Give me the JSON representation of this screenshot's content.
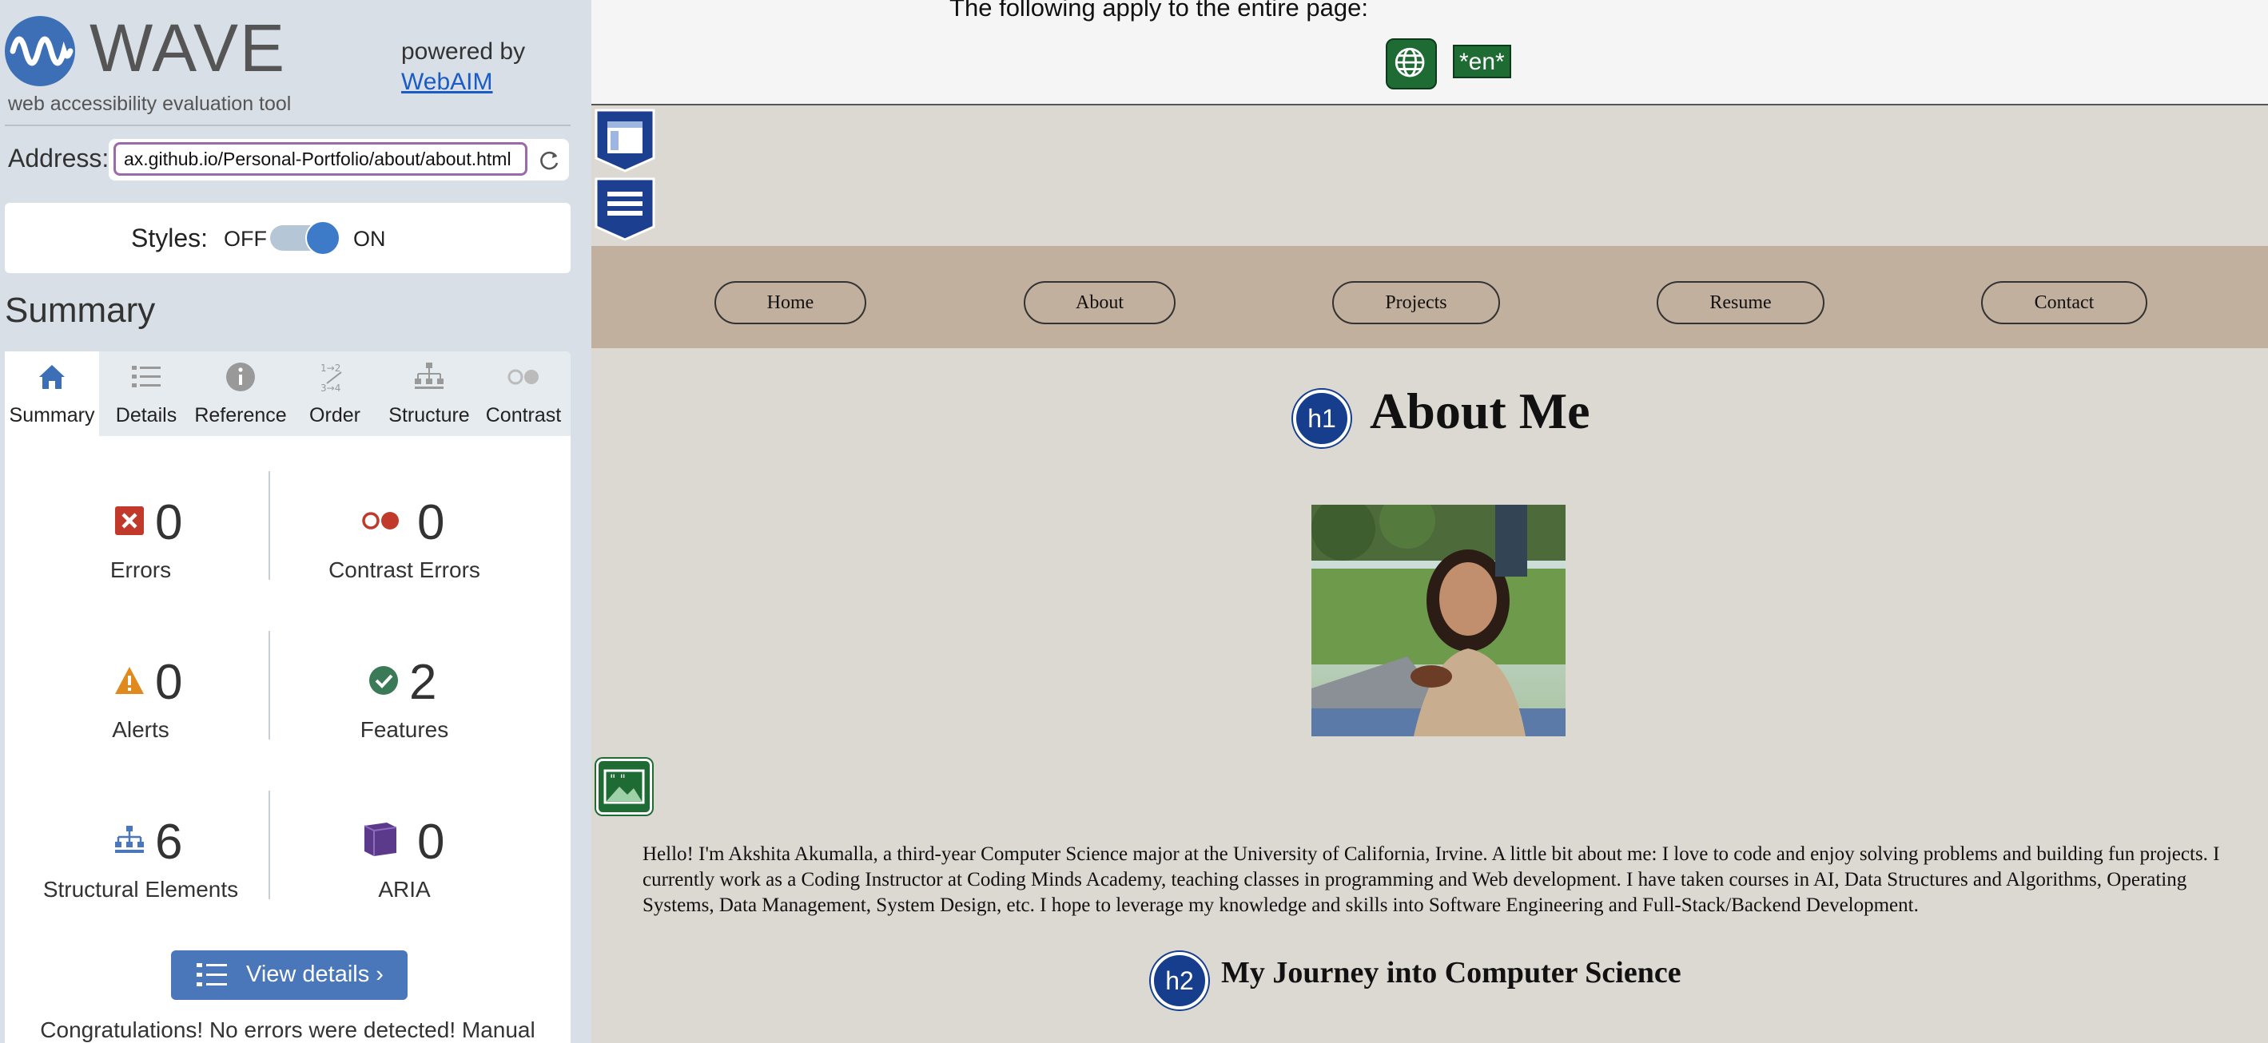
{
  "wave": {
    "brand": "WAVE",
    "subtitle": "web accessibility evaluation tool",
    "powered_by": "powered by",
    "webaim_link": "WebAIM",
    "address_label": "Address:",
    "address_value": "ax.github.io/Personal-Portfolio/about/about.html",
    "styles_label": "Styles:",
    "styles_off": "OFF",
    "styles_on": "ON",
    "styles_enabled": true,
    "summary_title": "Summary",
    "tabs": [
      {
        "label": "Summary",
        "icon": "home-icon",
        "active": true
      },
      {
        "label": "Details",
        "icon": "list-icon",
        "active": false
      },
      {
        "label": "Reference",
        "icon": "info-icon",
        "active": false
      },
      {
        "label": "Order",
        "icon": "order-icon",
        "active": false
      },
      {
        "label": "Structure",
        "icon": "structure-icon",
        "active": false
      },
      {
        "label": "Contrast",
        "icon": "contrast-icon",
        "active": false
      }
    ],
    "stats": {
      "errors": {
        "count": "0",
        "label": "Errors"
      },
      "contrast_errors": {
        "count": "0",
        "label": "Contrast Errors"
      },
      "alerts": {
        "count": "0",
        "label": "Alerts"
      },
      "features": {
        "count": "2",
        "label": "Features"
      },
      "structural": {
        "count": "6",
        "label": "Structural Elements"
      },
      "aria": {
        "count": "0",
        "label": "ARIA"
      }
    },
    "view_details": "View details ›",
    "congrats": "Congratulations! No errors were detected! Manual"
  },
  "page": {
    "note": "The following apply to the entire page:",
    "lang_badge": "*en*",
    "nav": [
      "Home",
      "About",
      "Projects",
      "Resume",
      "Contact"
    ],
    "h1_badge": "h1",
    "h1": "About Me",
    "bio": "Hello! I'm Akshita Akumalla, a third-year Computer Science major at the University of California, Irvine. A little bit about me: I love to code and enjoy solving problems and building fun projects. I currently work as a Coding Instructor at Coding Minds Academy, teaching classes in programming and Web development. I have taken courses in AI, Data Structures and Algorithms, Operating Systems, Data Management, System Design, etc. I hope to leverage my knowledge and skills into Software Engineering and Full-Stack/Backend Development.",
    "h2_badge": "h2",
    "h2": "My Journey into Computer Science"
  },
  "colors": {
    "sidebar_bg": "#d8dfe6",
    "wave_blue": "#4a76ba",
    "error_red": "#c0392b",
    "alert_orange": "#e08a1e",
    "feature_green": "#3b7a57",
    "aria_purple": "#5b3a8c",
    "nav_bar": "#c2b09e",
    "heading_badge": "#163e8c"
  }
}
